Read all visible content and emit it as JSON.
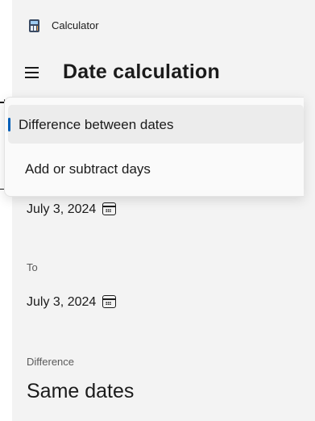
{
  "app": {
    "title": "Calculator",
    "icon": "calculator-icon"
  },
  "header": {
    "title": "Date calculation",
    "menu_icon": "hamburger-icon"
  },
  "mode_dropdown": {
    "options": [
      {
        "label": "Difference between dates",
        "selected": true
      },
      {
        "label": "Add or subtract days",
        "selected": false
      }
    ],
    "accent_color": "#005fb8"
  },
  "from": {
    "date": "July 3, 2024",
    "icon": "calendar-icon"
  },
  "to": {
    "label": "To",
    "date": "July 3, 2024",
    "icon": "calendar-icon"
  },
  "difference": {
    "label": "Difference",
    "value": "Same dates"
  }
}
